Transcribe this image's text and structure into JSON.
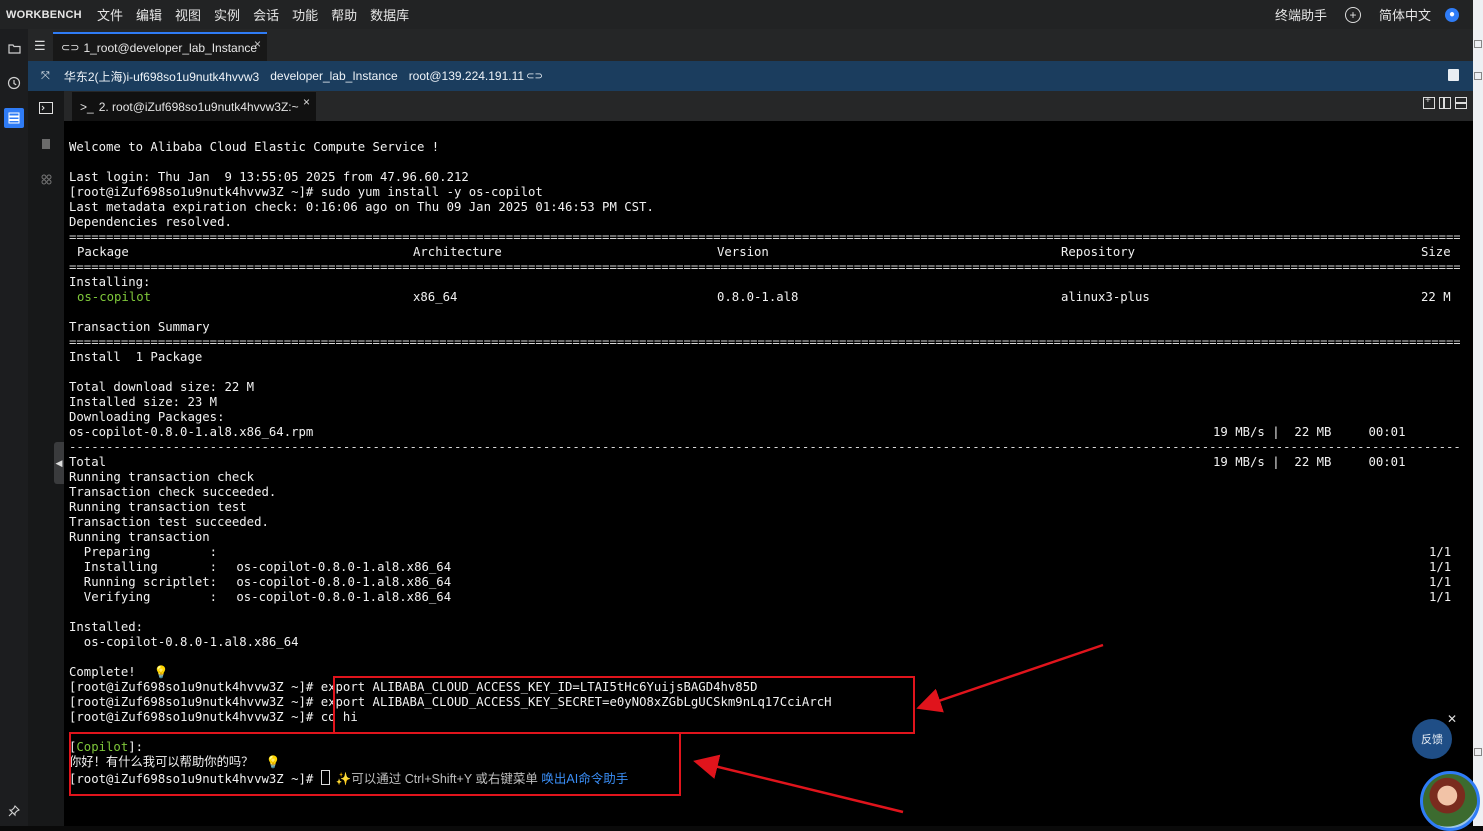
{
  "menubar": {
    "brand": "WORKBENCH",
    "items": [
      "文件",
      "编辑",
      "视图",
      "实例",
      "会话",
      "功能",
      "帮助",
      "数据库"
    ],
    "right": {
      "terminal_assistant": "终端助手",
      "language": "简体中文"
    }
  },
  "session_tab": {
    "label": "1_root@developer_lab_Instance",
    "close": "×"
  },
  "infobar": {
    "region_instance": "华东2(上海)i-uf698so1u9nutk4hvvw3",
    "instance_name": "developer_lab_Instance",
    "connection": "root@139.224.191.11"
  },
  "terminal_tab": {
    "label": "2. root@iZuf698so1u9nutk4hvvw3Z:~",
    "close": "×"
  },
  "terminal": {
    "welcome": "Welcome to Alibaba Cloud Elastic Compute Service !",
    "last_login": "Last login: Thu Jan  9 13:55:05 2025 from 47.96.60.212",
    "cmd_install": "[root@iZuf698so1u9nutk4hvvw3Z ~]# sudo yum install -y os-copilot",
    "metadata": "Last metadata expiration check: 0:16:06 ago on Thu 09 Jan 2025 01:46:53 PM CST.",
    "deps": "Dependencies resolved.",
    "table_headers": {
      "package": "Package",
      "arch": "Architecture",
      "version": "Version",
      "repo": "Repository",
      "size": "Size"
    },
    "installing_label": "Installing:",
    "package_row": {
      "package": "os-copilot",
      "arch": "x86_64",
      "version": "0.8.0-1.al8",
      "repo": "alinux3-plus",
      "size": "22 M"
    },
    "transaction_summary": "Transaction Summary",
    "install_count": "Install  1 Package",
    "total_download": "Total download size: 22 M",
    "installed_size": "Installed size: 23 M",
    "downloading": "Downloading Packages:",
    "rpm_file": "os-copilot-0.8.0-1.al8.x86_64.rpm",
    "rpm_stats": "19 MB/s |  22 MB     00:01",
    "total_label": "Total",
    "total_stats": "19 MB/s |  22 MB     00:01",
    "steps": [
      "Running transaction check",
      "Transaction check succeeded.",
      "Running transaction test",
      "Transaction test succeeded.",
      "Running transaction"
    ],
    "sub_steps": [
      {
        "label": "  Preparing        :",
        "target": "",
        "count": "1/1"
      },
      {
        "label": "  Installing       :",
        "target": " os-copilot-0.8.0-1.al8.x86_64",
        "count": "1/1"
      },
      {
        "label": "  Running scriptlet:",
        "target": " os-copilot-0.8.0-1.al8.x86_64",
        "count": "1/1"
      },
      {
        "label": "  Verifying        :",
        "target": " os-copilot-0.8.0-1.al8.x86_64",
        "count": "1/1"
      }
    ],
    "installed_label": "Installed:",
    "installed_pkg": "  os-copilot-0.8.0-1.al8.x86_64",
    "complete": "Complete!",
    "prompt": "[root@iZuf698so1u9nutk4hvvw3Z ~]#",
    "cmd_export_id": "export ALIBABA_CLOUD_ACCESS_KEY_ID=LTAI5tHc6YuijsBAGD4hv85D",
    "cmd_export_secret": "export ALIBABA_CLOUD_ACCESS_KEY_SECRET=e0yNO8xZGbLgUCSkm9nLq17CciArcH",
    "cmd_co": "co hi",
    "copilot_tag": "Copilot",
    "copilot_reply": "你好！有什么我可以帮助你的吗？",
    "hint_text": "可以通过 Ctrl+Shift+Y 或右键菜单 ",
    "hint_link": "唤出AI命令助手"
  },
  "feedback": {
    "label": "反馈"
  },
  "icons": [
    "folder-icon",
    "history-icon",
    "list-icon",
    "pin-icon",
    "terminal-icon",
    "file-icon",
    "grid-icon"
  ],
  "colors": {
    "accent": "#2f7cf6",
    "infobar": "#1b3d5e",
    "highlight_box": "#e0141c",
    "package_green": "#7ec73a"
  }
}
